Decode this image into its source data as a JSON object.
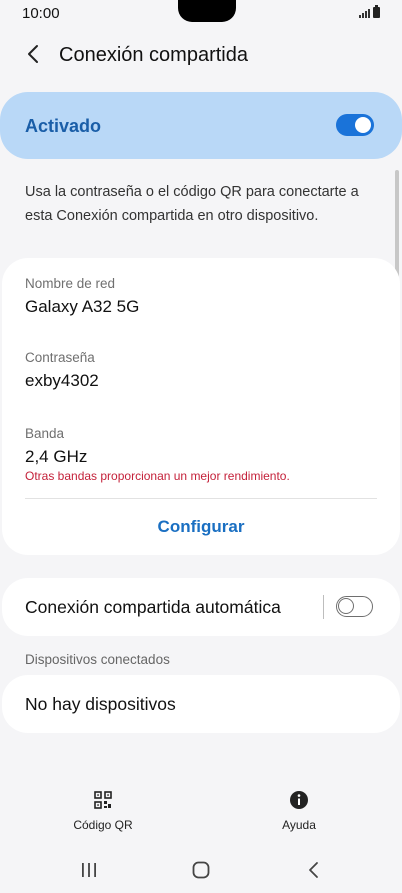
{
  "status_bar": {
    "time": "10:00"
  },
  "header": {
    "title": "Conexión compartida"
  },
  "master_switch": {
    "label": "Activado",
    "on": true,
    "accent": "#1a73d9",
    "background": "#b9d8f7"
  },
  "description": "Usa la contraseña o el código QR para conectarte a esta Conexión compartida en otro dispositivo.",
  "network": {
    "name_label": "Nombre de red",
    "name_value": "Galaxy A32 5G",
    "password_label": "Contraseña",
    "password_value": "exby4302",
    "band_label": "Banda",
    "band_value": "2,4 GHz",
    "band_warning": "Otras bandas proporcionan un mejor rendimiento.",
    "configure_button": "Configurar"
  },
  "auto_hotspot": {
    "label": "Conexión compartida automática",
    "on": false
  },
  "connected_devices": {
    "section_title": "Dispositivos conectados",
    "empty_text": "No hay dispositivos"
  },
  "toolbar": {
    "qr_label": "Código QR",
    "help_label": "Ayuda"
  },
  "nav_bar": {
    "icons": [
      "recents-icon",
      "home-icon",
      "back-icon"
    ]
  },
  "colors": {
    "warning": "#c4213a",
    "link": "#1a6fc2"
  }
}
